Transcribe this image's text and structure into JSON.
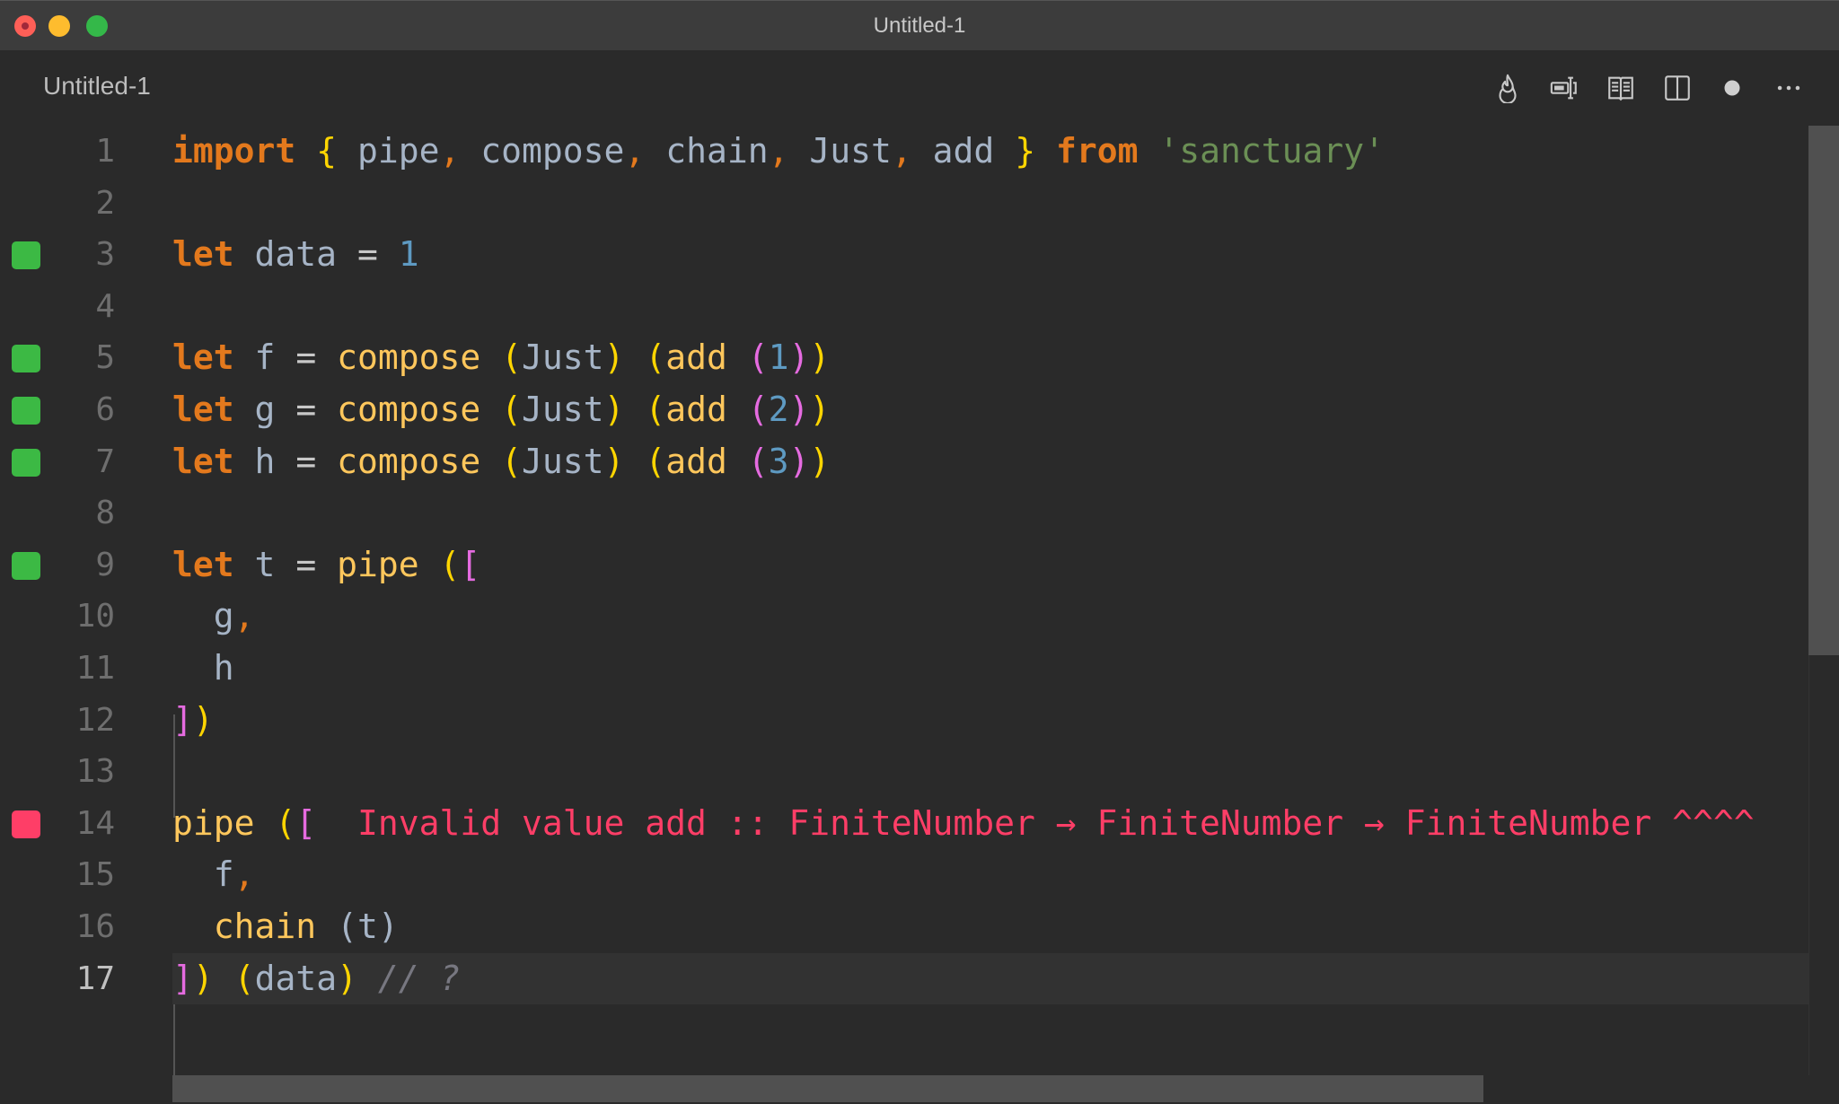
{
  "window": {
    "title": "Untitled-1",
    "controls": [
      "close",
      "minimize",
      "maximize"
    ]
  },
  "tab": {
    "title": "Untitled-1"
  },
  "toolbar": {
    "actions": [
      {
        "name": "flame-icon",
        "label": "Quokka / run"
      },
      {
        "name": "input-cursor-icon",
        "label": "Toggle input"
      },
      {
        "name": "open-preview-icon",
        "label": "Open preview"
      },
      {
        "name": "split-editor-icon",
        "label": "Split editor"
      },
      {
        "name": "unsaved-dot-icon",
        "label": "Unsaved changes"
      },
      {
        "name": "more-actions-icon",
        "label": "More actions"
      }
    ]
  },
  "editor": {
    "current_line": 17,
    "lines": [
      {
        "n": "1",
        "marker": null
      },
      {
        "n": "2",
        "marker": null
      },
      {
        "n": "3",
        "marker": "ok"
      },
      {
        "n": "4",
        "marker": null
      },
      {
        "n": "5",
        "marker": "ok"
      },
      {
        "n": "6",
        "marker": "ok"
      },
      {
        "n": "7",
        "marker": "ok"
      },
      {
        "n": "8",
        "marker": null
      },
      {
        "n": "9",
        "marker": "ok"
      },
      {
        "n": "10",
        "marker": null
      },
      {
        "n": "11",
        "marker": null
      },
      {
        "n": "12",
        "marker": null
      },
      {
        "n": "13",
        "marker": null
      },
      {
        "n": "14",
        "marker": "err"
      },
      {
        "n": "15",
        "marker": null
      },
      {
        "n": "16",
        "marker": null
      },
      {
        "n": "17",
        "marker": null
      }
    ],
    "tokens": {
      "l1": [
        "import",
        "{",
        "pipe",
        ",",
        "compose",
        ",",
        "chain",
        ",",
        "Just",
        ",",
        "add",
        "}",
        "from",
        "'sanctuary'"
      ],
      "l3": [
        "let",
        "data",
        "=",
        "1"
      ],
      "l5": [
        "let",
        "f",
        "=",
        "compose",
        "(",
        "Just",
        ")",
        "(",
        "add",
        "(",
        "1",
        ")",
        ")"
      ],
      "l6": [
        "let",
        "g",
        "=",
        "compose",
        "(",
        "Just",
        ")",
        "(",
        "add",
        "(",
        "2",
        ")",
        ")"
      ],
      "l7": [
        "let",
        "h",
        "=",
        "compose",
        "(",
        "Just",
        ")",
        "(",
        "add",
        "(",
        "3",
        ")",
        ")"
      ],
      "l9": [
        "let",
        "t",
        "=",
        "pipe",
        "(",
        "["
      ],
      "l10": [
        "g",
        ","
      ],
      "l11": [
        "h"
      ],
      "l12": [
        "]",
        ")"
      ],
      "l14": [
        "pipe",
        "(",
        "["
      ],
      "l14_error": "Invalid value add :: FiniteNumber → FiniteNumber → FiniteNumber ^^^^",
      "l15": [
        "f",
        ","
      ],
      "l16": [
        "chain",
        "(",
        "t",
        ")"
      ],
      "l17": [
        "]",
        ")",
        "(",
        "data",
        ")",
        "// ?"
      ]
    }
  },
  "colors": {
    "keyword": "#e3791d",
    "function": "#fec75c",
    "identifier": "#a6b4c6",
    "number": "#5e9ac2",
    "string": "#6b8f55",
    "error": "#fe3e67",
    "ok_marker": "#3cb944",
    "bracket_pair_1": "#fed501",
    "bracket_pair_2": "#e56be0"
  }
}
